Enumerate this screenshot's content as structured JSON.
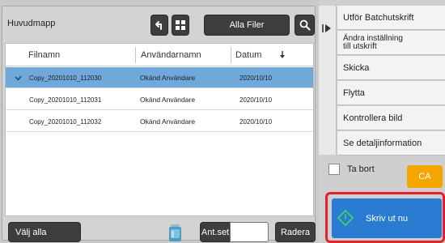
{
  "header": {
    "folder_title": "Huvudmapp",
    "filter_label": "Alla Filer",
    "icons": [
      "up-arrow-icon",
      "grid-icon",
      "search-icon"
    ]
  },
  "list": {
    "columns": {
      "name": "Filnamn",
      "user": "Användarnamn",
      "date": "Datum",
      "sort_indicator": "down-arrow-icon"
    },
    "rows": [
      {
        "name": "Copy_20201010_112030",
        "user": "Okänd Användare",
        "date": "2020/10/10",
        "selected": true
      },
      {
        "name": "Copy_20201010_112031",
        "user": "Okänd Användare",
        "date": "2020/10/10",
        "selected": false
      },
      {
        "name": "Copy_20201010_112032",
        "user": "Okänd Användare",
        "date": "2020/10/10",
        "selected": false
      }
    ]
  },
  "bottom_bar": {
    "select_all_label": "Välj alla",
    "copies_label": "Ant.set",
    "copies_value": "",
    "delete_label": "Radera"
  },
  "actions": [
    {
      "label": "Utför Batchutskrift"
    },
    {
      "label_line1": "Ändra inställning",
      "label_line2": "till utskrift"
    },
    {
      "label": "Skicka"
    },
    {
      "label": "Flytta"
    },
    {
      "label": "Kontrollera bild"
    },
    {
      "label": "Se detaljinformation"
    }
  ],
  "options": {
    "delete_checkbox_label": "Ta bort",
    "delete_checkbox_checked": false
  },
  "ca_label": "CA",
  "start_label": "Skriv ut nu",
  "colors": {
    "selected_row": "#6fa9db",
    "start_button": "#2a7bd2",
    "ca_button": "#f5a500",
    "highlight_outline": "#e0212e",
    "dark_button": "#3d3d3d"
  }
}
